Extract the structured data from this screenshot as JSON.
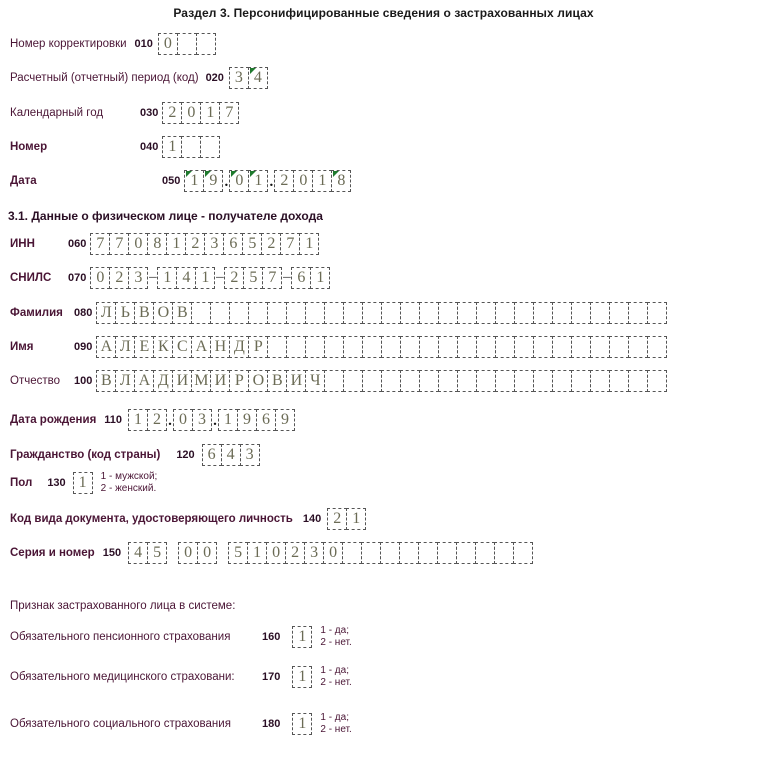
{
  "document": {
    "title": "Раздел 3. Персонифицированные сведения о застрахованных лицах",
    "section_31_heading": "3.1. Данные о физическом лице - получателе дохода",
    "insured_sign_heading": "Признак застрахованного лица в системе:"
  },
  "colors": {
    "label": "#4a1535",
    "value": "#6b6b55",
    "marker": "#1f7a2e",
    "background": "#ffffff"
  },
  "fields": {
    "correction_number": {
      "label": "Номер корректировки",
      "code": "010",
      "cells": [
        "0",
        "",
        ""
      ]
    },
    "reporting_period": {
      "label": "Расчетный (отчетный) период (код)",
      "code": "020",
      "cells": [
        "3",
        "4"
      ],
      "marked_cells": [
        1
      ]
    },
    "calendar_year": {
      "label": "Календарный год",
      "code": "030",
      "cells": [
        "2",
        "0",
        "1",
        "7"
      ]
    },
    "number": {
      "label": "Номер",
      "code": "040",
      "cells": [
        "1",
        "",
        ""
      ]
    },
    "date": {
      "label": "Дата",
      "code": "050",
      "cells": [
        "1",
        "9",
        ".",
        "0",
        "1",
        ".",
        "2",
        "0",
        "1",
        "8"
      ],
      "marked_cells": [
        0,
        1,
        3,
        4,
        9
      ]
    },
    "inn": {
      "label": "ИНН",
      "code": "060",
      "cells": [
        "7",
        "7",
        "0",
        "8",
        "1",
        "2",
        "3",
        "6",
        "5",
        "2",
        "7",
        "1"
      ]
    },
    "snils": {
      "label": "СНИЛС",
      "code": "070",
      "cells": [
        "0",
        "2",
        "3",
        "–",
        "1",
        "4",
        "1",
        "–",
        "2",
        "5",
        "7",
        "–",
        "6",
        "1"
      ]
    },
    "last_name": {
      "label": "Фамилия",
      "code": "080",
      "value": "ЛЬВОВ",
      "total_cells": 30
    },
    "first_name": {
      "label": "Имя",
      "code": "090",
      "value": "АЛЕКСАНДР",
      "total_cells": 30
    },
    "middle_name": {
      "label": "Отчество",
      "code": "100",
      "value": "ВЛАДИМИРОВИЧ",
      "total_cells": 30
    },
    "birth_date": {
      "label": "Дата рождения",
      "code": "110",
      "cells": [
        "1",
        "2",
        ".",
        "0",
        "3",
        ".",
        "1",
        "9",
        "6",
        "9"
      ]
    },
    "citizenship": {
      "label": "Гражданство (код страны)",
      "code": "120",
      "cells": [
        "6",
        "4",
        "3"
      ]
    },
    "gender": {
      "label": "Пол",
      "code": "130",
      "cells": [
        "1"
      ],
      "legend_line1": "1 - мужской;",
      "legend_line2": "2 - женский."
    },
    "document_code": {
      "label": "Код вида документа, удостоверяющего личность",
      "code": "140",
      "cells": [
        "2",
        "1"
      ]
    },
    "series_number": {
      "label": "Серия и номер",
      "code": "150",
      "group1": [
        "4",
        "5"
      ],
      "group2": [
        "0",
        "0"
      ],
      "group3": [
        "5",
        "1",
        "0",
        "2",
        "3",
        "0",
        "",
        "",
        "",
        "",
        "",
        "",
        "",
        "",
        "",
        ""
      ]
    },
    "pension_insurance": {
      "label": "Обязательного пенсионного страхования",
      "code": "160",
      "cells": [
        "1"
      ],
      "legend_line1": "1 - да;",
      "legend_line2": "2 - нет."
    },
    "medical_insurance": {
      "label": "Обязательного медицинского страховани:",
      "code": "170",
      "cells": [
        "1"
      ],
      "legend_line1": "1 - да;",
      "legend_line2": "2 - нет."
    },
    "social_insurance": {
      "label": "Обязательного социального страхования",
      "code": "180",
      "cells": [
        "1"
      ],
      "legend_line1": "1 - да;",
      "legend_line2": "2 - нет."
    }
  }
}
